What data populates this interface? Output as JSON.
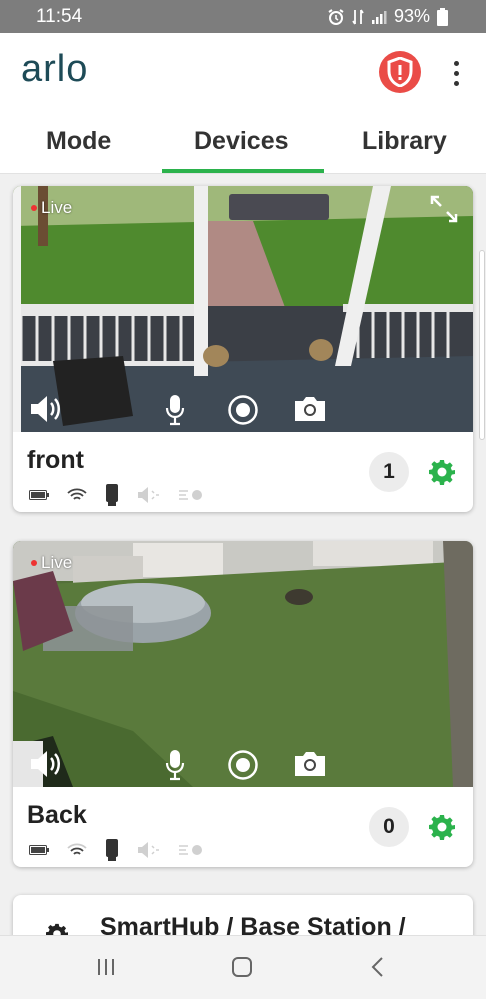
{
  "status_bar": {
    "time": "11:54",
    "battery_pct": "93%"
  },
  "app": {
    "logo": "arlo"
  },
  "tabs": [
    {
      "label": "Mode"
    },
    {
      "label": "Devices",
      "active": true
    },
    {
      "label": "Library"
    }
  ],
  "devices": [
    {
      "name": "front",
      "live_label": "Live",
      "notification_count": "1",
      "status_icons": [
        "battery-icon",
        "wifi-icon",
        "camera-device-icon",
        "speaker-muted-icon",
        "motion-icon"
      ]
    },
    {
      "name": "Back",
      "live_label": "Live",
      "notification_count": "0",
      "status_icons": [
        "battery-icon",
        "wifi-icon",
        "camera-device-icon",
        "speaker-muted-icon",
        "motion-icon"
      ]
    }
  ],
  "base_station": {
    "title": "SmartHub / Base Station /"
  },
  "colors": {
    "accent_green": "#2bb24c",
    "alert_red": "#ea4c47",
    "logo": "#1e4b57"
  }
}
